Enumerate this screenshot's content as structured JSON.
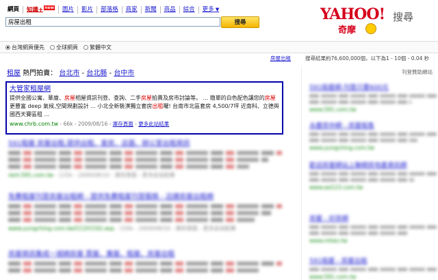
{
  "tabs": [
    {
      "label": "網頁",
      "active": true
    },
    {
      "label": "知識+",
      "badge": "new"
    },
    {
      "label": "圖片"
    },
    {
      "label": "影片"
    },
    {
      "label": "部落格"
    },
    {
      "label": "商家"
    },
    {
      "label": "新聞"
    },
    {
      "label": "商品"
    },
    {
      "label": "綜合"
    },
    {
      "label": "更多"
    }
  ],
  "logo": {
    "brand": "YAHOO!",
    "suffix": "搜尋",
    "sub": "奇摩"
  },
  "search": {
    "value": "房屋出租",
    "button": "搜尋"
  },
  "scope": {
    "options": [
      "台灣網頁優先",
      "全球網頁",
      "繁體中文"
    ],
    "selected": 0
  },
  "info": {
    "query": "房屋出租",
    "stats": "搜尋結果約76,600,000個，以下為1 - 10個 - 0.04 秒"
  },
  "breadcrumb": {
    "category": "租屋",
    "label": "熱門拍賣：",
    "links": [
      "台北市",
      "台北縣",
      "台中市"
    ],
    "sep": " - "
  },
  "sponsored_label": "刊登贊助網站",
  "featured": {
    "title": "大管家租屋網",
    "snippet_parts": [
      {
        "t": "提供全國公寓、華廈、"
      },
      {
        "t": "房屋",
        "hl": true
      },
      {
        "t": "相屋資訊刊登、查詢、二手"
      },
      {
        "t": "房屋",
        "hl": true
      },
      {
        "t": "拍賣及房市討論等。 ... 簡單的白色配色讓您的"
      },
      {
        "t": "房屋",
        "hl": true
      },
      {
        "t": "更豐富 deep 氣候,空間規劃設計 ... 小北全新裝潢獨立套房"
      },
      {
        "t": "出租",
        "hl": true
      },
      {
        "t": "囉! 台南市北區套房 4,500/7坪 近南科、立德與國西天賽區租 ..."
      }
    ],
    "url": "www.chrb.com.tw",
    "size": "66k",
    "date": "2009/08/16",
    "cache": "庫存頁面",
    "more": "更多此站結果"
  },
  "results": [
    {
      "title": "591租屋 房屋出租,提供出租、套房、店面、辦公室出租資訊",
      "url": "rent.591.com.tw",
      "meta": " - 125k - 2009/08/10 - 庫存頁面 - 更多此站結果"
    },
    {
      "title": "免費租屋刊登房屋出租網 - 提供免費租屋刊登服務 - 迅捷房屋出租網",
      "url": "www.yungching.com.tw/CC2/CC02.asp",
      "meta": " - 150k - 2009/08/16 - 庫存頁面 - 更多此站結果"
    },
    {
      "title": "房屋資訊集成一城網房屋 買屋、賣屋、租屋、房屋出租",
      "url": "",
      "meta": ""
    }
  ],
  "ads": [
    {
      "title": "591租屋網-刊登只要600元",
      "url": "www.591.com.tw"
    },
    {
      "title": "永慶房仲網 - 房屋租售",
      "url": "www.yungching.com.tw"
    },
    {
      "title": "歡迎房屋網站上聯網房地產資訊網",
      "url": "www.ea123.com.tw"
    },
    {
      "title": "房屋 - 好房網",
      "url": "www.mhes.tw"
    },
    {
      "title": "591租屋 - 房屋出租",
      "url": "www.591.com.tw"
    }
  ]
}
